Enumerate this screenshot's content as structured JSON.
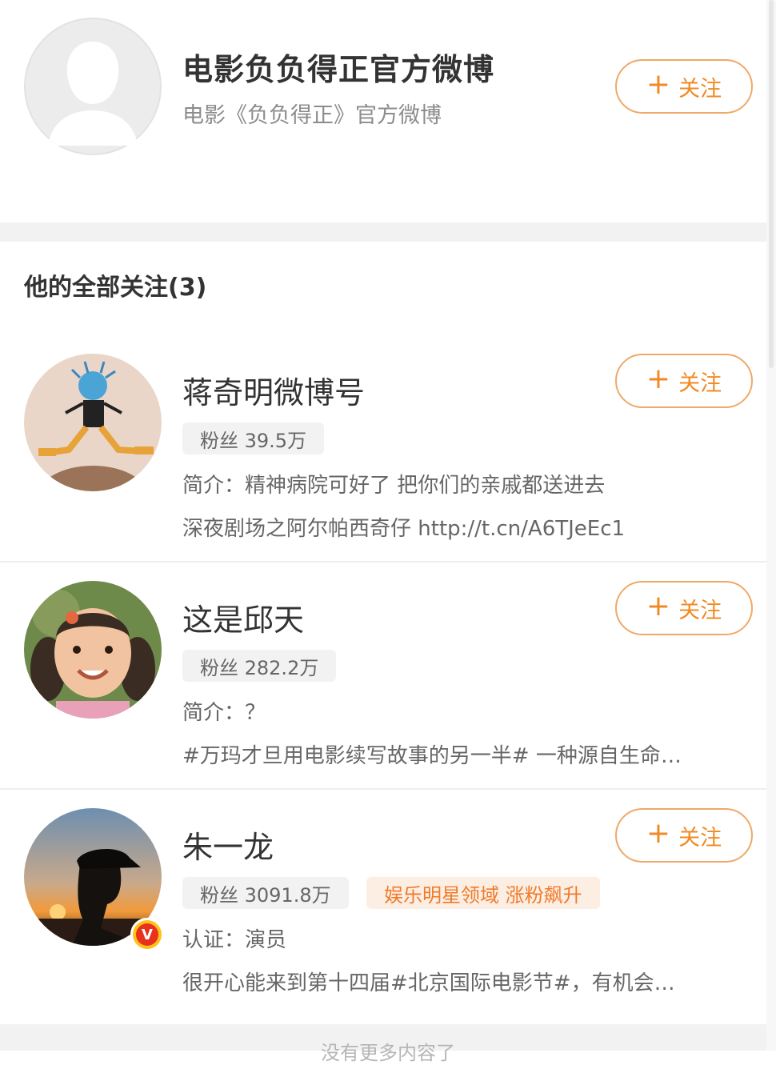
{
  "profile": {
    "name": "电影负负得正官方微博",
    "description": "电影《负负得正》官方微博",
    "follow_label": "关注"
  },
  "section_title": "他的全部关注(3)",
  "users": [
    {
      "name": "蒋奇明微博号",
      "fans": "粉丝 39.5万",
      "line1": "简介：精神病院可好了 把你们的亲戚都送进去",
      "line2": "深夜剧场之阿尔帕西奇仔 http://t.cn/A6TJeEc1",
      "follow_label": "关注"
    },
    {
      "name": "这是邱天",
      "fans": "粉丝 282.2万",
      "line1": "简介：？",
      "line2": "#万玛才旦用电影续写故事的另一半# 一种源自生命…",
      "follow_label": "关注"
    },
    {
      "name": "朱一龙",
      "fans": "粉丝 3091.8万",
      "tag": "娱乐明星领域 涨粉飙升",
      "line1": "认证：演员",
      "line2": "很开心能来到第十四届#北京国际电影节#，有机会…",
      "follow_label": "关注",
      "verified_badge": "V"
    }
  ],
  "footer": "没有更多内容了",
  "colors": {
    "accent": "#f08a24",
    "button_border": "#f0a868",
    "tag_bg": "#fdeee4",
    "tag_text": "#ee7b2a"
  }
}
